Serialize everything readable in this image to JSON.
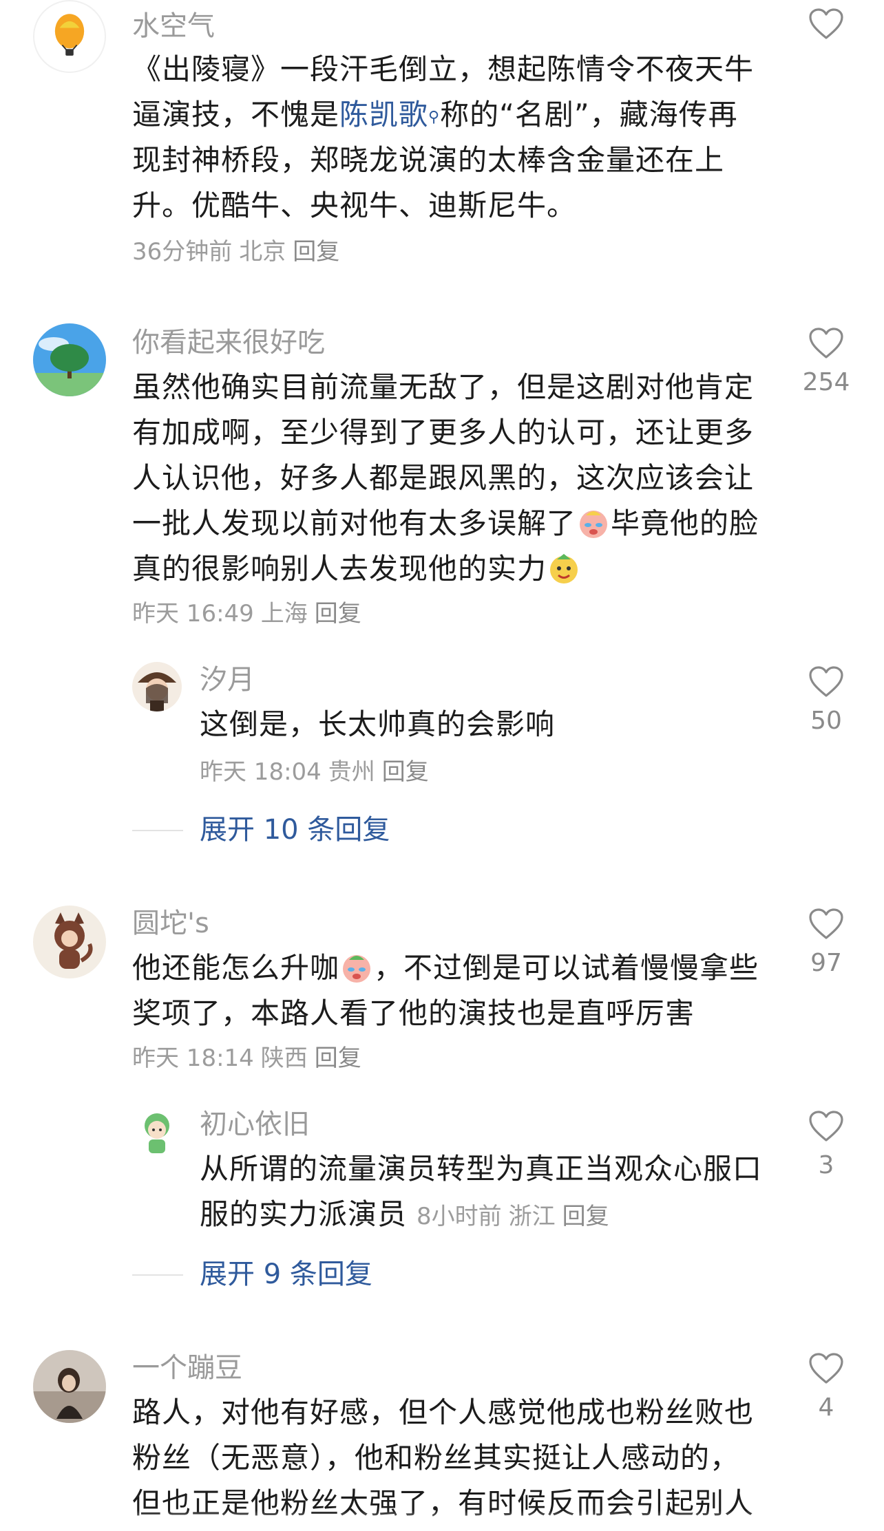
{
  "comments": [
    {
      "name": "水空气",
      "text_before_link": "《出陵寝》一段汗毛倒立，想起陈情令不夜天牛逼演技，不愧是",
      "link": "陈凯歌",
      "text_after_link": "称的“名剧”，藏海传再现封神桥段，郑晓龙说演的太棒含金量还在上升。优酷牛、央视牛、迪斯尼牛。",
      "time": "36分钟前",
      "location": "北京",
      "reply": "回复"
    },
    {
      "name": "你看起来很好吃",
      "text_part1": "虽然他确实目前流量无敌了，但是这剧对他肯定有加成啊，至少得到了更多人的认可，还让更多人认识他，好多人都是跟风黑的，这次应该会让一批人发现以前对他有太多误解了",
      "text_part2": "毕竟他的脸真的很影响别人去发现他的实力",
      "time": "昨天 16:49",
      "location": "上海",
      "reply": "回复",
      "likes": "254",
      "subreply": {
        "name": "汐月",
        "text": "这倒是，长太帅真的会影响",
        "time": "昨天 18:04",
        "location": "贵州",
        "reply": "回复",
        "likes": "50"
      },
      "expand": "展开 10 条回复"
    },
    {
      "name": "圆坨's",
      "text_part1": "他还能怎么升咖",
      "text_part2": "，不过倒是可以试着慢慢拿些奖项了，本路人看了他的演技也是直呼厉害",
      "time": "昨天 18:14",
      "location": "陕西",
      "reply": "回复",
      "likes": "97",
      "subreply": {
        "name": "初心依旧",
        "text": "从所谓的流量演员转型为真正当观众心服口服的实力派演员",
        "time": "8小时前",
        "location": "浙江",
        "reply": "回复",
        "likes": "3"
      },
      "expand": "展开 9 条回复"
    },
    {
      "name": "一个蹦豆",
      "text": "路人，对他有好感，但个人感觉他成也粉丝败也粉丝（无恶意），他和粉丝其实挺让人感动的，但也正是他粉丝太强了，有时候反而会引起别人",
      "likes": "4"
    }
  ],
  "colors": {
    "link": "#2f5a9c",
    "meta": "#9c9c9c",
    "name": "#9a9a9a",
    "text": "#1c1c1c"
  }
}
